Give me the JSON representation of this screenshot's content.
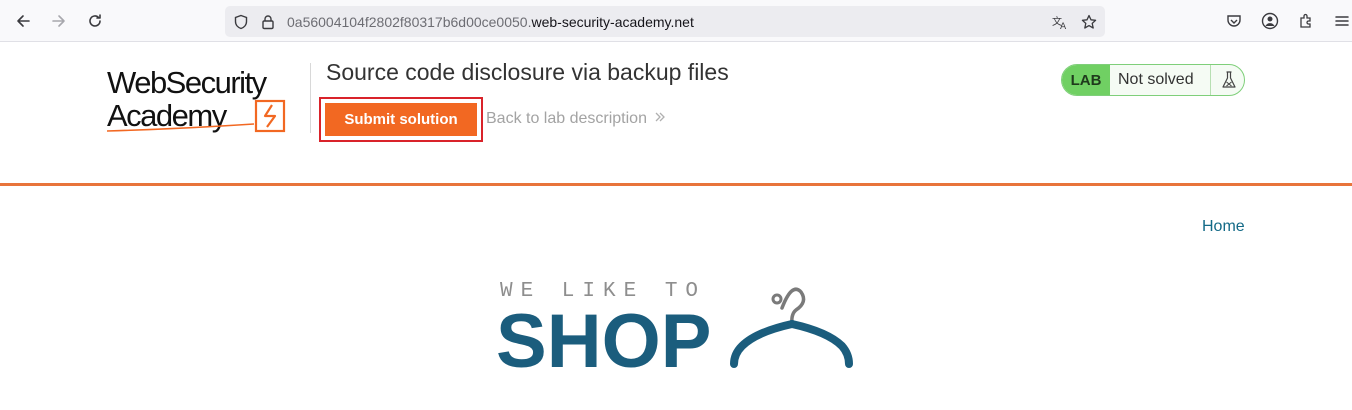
{
  "browser": {
    "url_prefix": "0a56004104f2802f80317b6d00ce0050.",
    "url_domain": "web-security-academy.net"
  },
  "lab": {
    "logo_line1": "WebSecurity",
    "logo_line2": "Academy",
    "title": "Source code disclosure via backup files",
    "submit_label": "Submit solution",
    "back_label": "Back to lab description",
    "status_tag": "LAB",
    "status_text": "Not solved"
  },
  "page": {
    "home_label": "Home",
    "shop_tagline": "WE LIKE TO",
    "shop_word": "SHOP"
  },
  "colors": {
    "accent": "#f26822",
    "highlight": "#d9232a",
    "link": "#136a87",
    "status_green": "#70d063"
  }
}
